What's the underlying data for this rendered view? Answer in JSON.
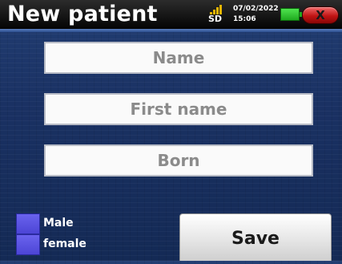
{
  "header": {
    "title": "New patient",
    "storage_label": "SD",
    "date": "07/02/2022",
    "time": "15:06",
    "icons": {
      "signal": "signal-bars-icon",
      "battery": "battery-icon",
      "close": "close-x-icon"
    },
    "close_label": "X",
    "colors": {
      "signal": "#e6b400",
      "battery": "#2ecc2e",
      "close": "#d01a1a"
    }
  },
  "form": {
    "name_placeholder": "Name",
    "first_name_placeholder": "First name",
    "born_placeholder": "Born"
  },
  "gender": {
    "male_label": "Male",
    "female_label": "female",
    "checkbox_color": "#5a52e6"
  },
  "actions": {
    "save_label": "Save"
  }
}
